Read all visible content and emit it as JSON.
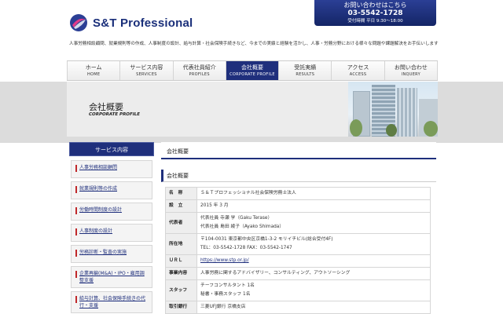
{
  "header": {
    "logo_text": "S&T Professional",
    "contact_line1": "お問い合わせはこちら",
    "contact_phone": "03-5542-1728",
    "contact_hours": "受付時間 平日 9:30〜18:00",
    "intro": "人事労務相談顧問、就業規則等の作成、人事制度の設計、給与計算・社会保険手続きなど、今までの実績と経験を活かし、人事・労務分野における様々な問題や課題解決をお手伝いします"
  },
  "nav": [
    {
      "ja": "ホーム",
      "en": "HOME"
    },
    {
      "ja": "サービス内容",
      "en": "SERVICES"
    },
    {
      "ja": "代表社員紹介",
      "en": "PROFILES"
    },
    {
      "ja": "会社概要",
      "en": "CORPORATE PROFILE"
    },
    {
      "ja": "受託実績",
      "en": "RESULTS"
    },
    {
      "ja": "アクセス",
      "en": "ACCESS"
    },
    {
      "ja": "お問い合わせ",
      "en": "INQUERY"
    }
  ],
  "banner": {
    "title": "会社概要",
    "subtitle": "CORPORATE PROFILE"
  },
  "sidebar": {
    "heading": "サービス内容",
    "items": [
      {
        "label": "人事労務相談顧問"
      },
      {
        "label": "就業規則等の作成"
      },
      {
        "label": "労働時間制度の設計"
      },
      {
        "label": "人事制度の設計"
      },
      {
        "label": "労務診断・監査の実施"
      },
      {
        "label": "企業再編(M&A)・IPO・雇用調整支援"
      },
      {
        "label": "給与計算、社会保険手続きの代行・支援"
      }
    ]
  },
  "main": {
    "heading": "会社概要",
    "section": "会社概要",
    "rows": [
      {
        "key": "名　称",
        "lines": [
          "Ｓ＆Ｔプロフェッショナル社会保険労務士法人"
        ]
      },
      {
        "key": "設　立",
        "lines": [
          "2015 年 3 月"
        ]
      },
      {
        "key": "代表者",
        "lines": [
          "代表社員 寺瀬 学（Gaku Terase）",
          "代表社員 島田 綾子（Ayako Shimada）"
        ]
      },
      {
        "key": "所在地",
        "lines": [
          "〒104-0031 東京都中央区京橋1-3-2 モリイチビル(総合受付4F)",
          "TEL：03-5542-1728 FAX：03-5542-1747"
        ]
      },
      {
        "key": "ＵＲＬ",
        "lines": [
          "https://www.stp.or.jp/"
        ]
      },
      {
        "key": "事業内容",
        "lines": [
          "人事労務に関するアドバイザリー、コンサルティング、アウトソーシング"
        ]
      },
      {
        "key": "スタッフ",
        "lines": [
          "チーフコンサルタント 1名",
          "秘書・事務スタッフ 1名"
        ]
      },
      {
        "key": "取引銀行",
        "lines": [
          "三菱UFJ銀行 京橋支店"
        ]
      }
    ]
  },
  "colors": {
    "brand_navy": "#1f2f7c",
    "accent_red": "#c0282a"
  }
}
